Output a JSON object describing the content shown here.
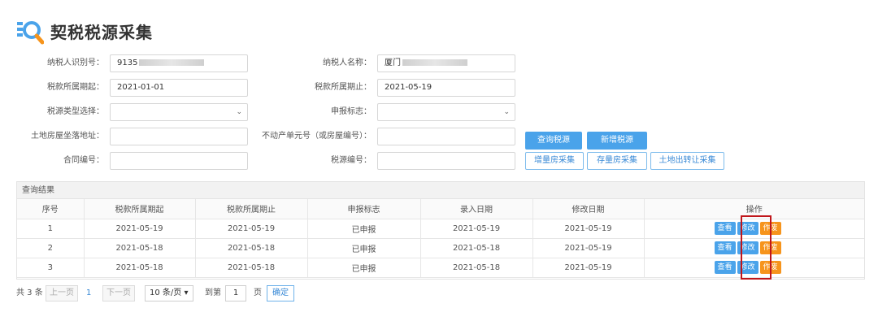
{
  "header": {
    "title": "契税税源采集",
    "logo_icon": "search-doc-icon"
  },
  "form": {
    "taxpayer_id": {
      "label": "纳税人识别号：",
      "value": "9135"
    },
    "taxpayer_name": {
      "label": "纳税人名称：",
      "value": "厦门"
    },
    "period_start": {
      "label": "税款所属期起：",
      "value": "2021-01-01"
    },
    "period_end": {
      "label": "税款所属期止：",
      "value": "2021-05-19"
    },
    "source_type": {
      "label": "税源类型选择：",
      "value": ""
    },
    "declare_flag": {
      "label": "申报标志：",
      "value": ""
    },
    "address": {
      "label": "土地房屋坐落地址：",
      "value": ""
    },
    "unit_no": {
      "label": "不动产单元号（或房屋编号）：",
      "value": ""
    },
    "contract_no": {
      "label": "合同编号：",
      "value": ""
    },
    "source_no": {
      "label": "税源编号：",
      "value": ""
    }
  },
  "buttons": {
    "query": "查询税源",
    "add": "新增税源",
    "incremental": "增量房采集",
    "stock": "存量房采集",
    "land": "土地出转让采集"
  },
  "results": {
    "caption": "查询结果",
    "columns": [
      "序号",
      "税款所属期起",
      "税款所属期止",
      "申报标志",
      "录入日期",
      "修改日期",
      "操作"
    ],
    "rows": [
      [
        "1",
        "2021-05-19",
        "2021-05-19",
        "已申报",
        "2021-05-19",
        "2021-05-19"
      ],
      [
        "2",
        "2021-05-18",
        "2021-05-18",
        "已申报",
        "2021-05-18",
        "2021-05-19"
      ],
      [
        "3",
        "2021-05-18",
        "2021-05-18",
        "已申报",
        "2021-05-18",
        "2021-05-19"
      ]
    ],
    "actions": {
      "view": "查看",
      "edit": "修改",
      "void": "作废"
    }
  },
  "pagination": {
    "total": "共 3 条",
    "prev": "上一页",
    "current": "1",
    "next": "下一页",
    "page_size": "10 条/页 ▾",
    "goto_prefix": "到第",
    "goto_value": "1",
    "goto_suffix": "页",
    "confirm": "确定"
  },
  "colors": {
    "primary": "#4aa3ea",
    "void": "#f6941c",
    "highlight": "#c0161b"
  }
}
